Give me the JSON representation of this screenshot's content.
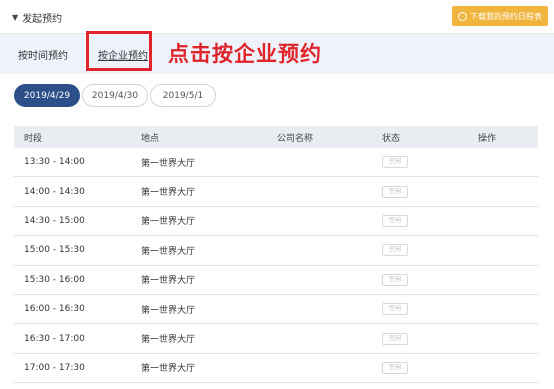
{
  "header": {
    "title": "发起预约",
    "download_label": "下载我的预约日程表"
  },
  "tabs": {
    "by_time": "按时间预约",
    "by_company": "按企业预约"
  },
  "annotation": "点击按企业预约",
  "dates": [
    "2019/4/29",
    "2019/4/30",
    "2019/5/1"
  ],
  "table": {
    "headers": [
      "时段",
      "地点",
      "公司名称",
      "状态",
      "操作"
    ],
    "rows": [
      {
        "time": "13:30 - 14:00",
        "place": "第一世界大厅",
        "company": "",
        "status": "空闲"
      },
      {
        "time": "14:00 - 14:30",
        "place": "第一世界大厅",
        "company": "",
        "status": "空闲"
      },
      {
        "time": "14:30 - 15:00",
        "place": "第一世界大厅",
        "company": "",
        "status": "空闲"
      },
      {
        "time": "15:00 - 15:30",
        "place": "第一世界大厅",
        "company": "",
        "status": "空闲"
      },
      {
        "time": "15:30 - 16:00",
        "place": "第一世界大厅",
        "company": "",
        "status": "空闲"
      },
      {
        "time": "16:00 - 16:30",
        "place": "第一世界大厅",
        "company": "",
        "status": "空闲"
      },
      {
        "time": "16:30 - 17:00",
        "place": "第一世界大厅",
        "company": "",
        "status": "空闲"
      },
      {
        "time": "17:00 - 17:30",
        "place": "第一世界大厅",
        "company": "",
        "status": "空闲"
      }
    ]
  },
  "colors": {
    "accent_button": "#f0b43c",
    "active_date": "#2c4f8a",
    "annotation_red": "#e0242a"
  }
}
